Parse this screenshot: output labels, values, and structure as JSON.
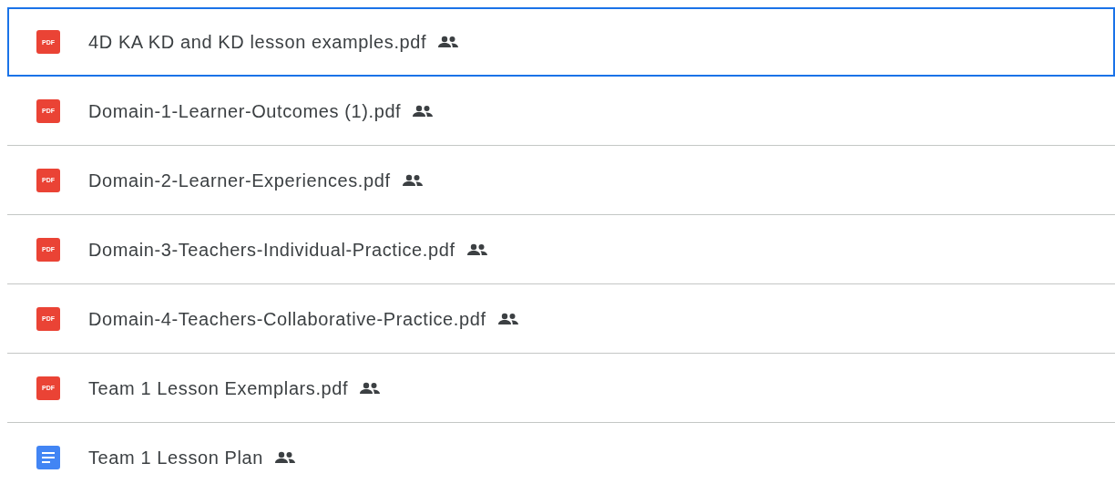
{
  "files": [
    {
      "name": "4D KA KD and KD lesson examples.pdf",
      "kind": "pdf",
      "icon_text": "PDF",
      "shared": true,
      "selected": true
    },
    {
      "name": "Domain-1-Learner-Outcomes (1).pdf",
      "kind": "pdf",
      "icon_text": "PDF",
      "shared": true,
      "selected": false
    },
    {
      "name": "Domain-2-Learner-Experiences.pdf",
      "kind": "pdf",
      "icon_text": "PDF",
      "shared": true,
      "selected": false
    },
    {
      "name": "Domain-3-Teachers-Individual-Practice.pdf",
      "kind": "pdf",
      "icon_text": "PDF",
      "shared": true,
      "selected": false
    },
    {
      "name": "Domain-4-Teachers-Collaborative-Practice.pdf",
      "kind": "pdf",
      "icon_text": "PDF",
      "shared": true,
      "selected": false
    },
    {
      "name": "Team 1 Lesson Exemplars.pdf",
      "kind": "pdf",
      "icon_text": "PDF",
      "shared": true,
      "selected": false
    },
    {
      "name": "Team 1 Lesson Plan",
      "kind": "doc",
      "shared": true,
      "selected": false
    }
  ]
}
